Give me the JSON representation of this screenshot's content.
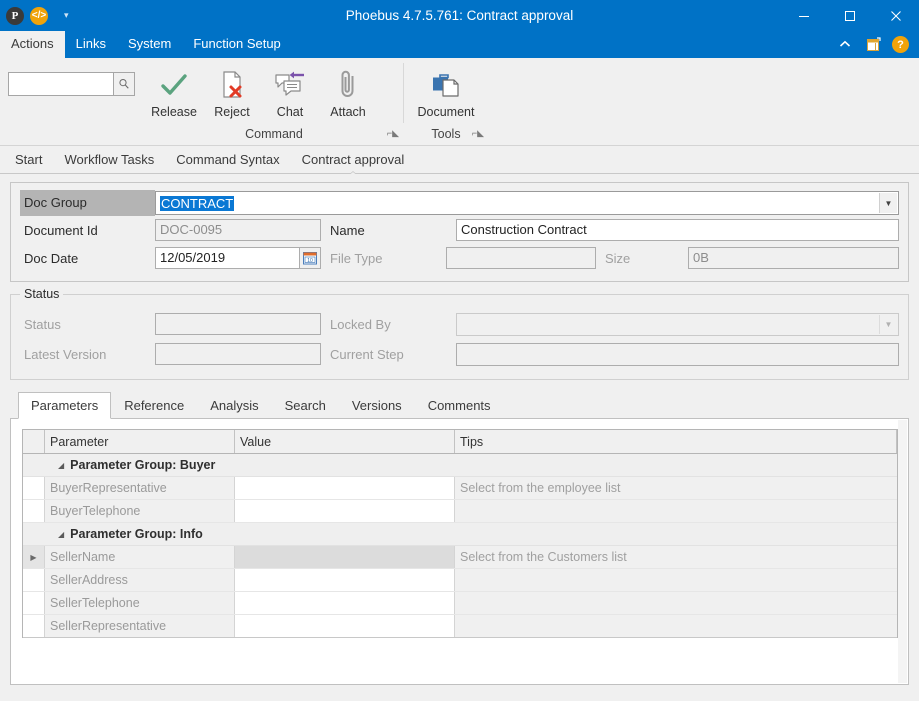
{
  "window": {
    "title": "Phoebus 4.7.5.761: Contract approval",
    "quick_access": [
      {
        "name": "app-logo-icon",
        "glyph": "P"
      },
      {
        "name": "code-icon",
        "glyph": "</>"
      },
      {
        "name": "customize-quick-access-caret",
        "glyph": "▾"
      }
    ],
    "controls": {
      "minimize": "Minimize",
      "maximize": "Maximize",
      "close": "Close"
    }
  },
  "ribbon": {
    "tabs": [
      {
        "label": "Actions",
        "active": true
      },
      {
        "label": "Links",
        "active": false
      },
      {
        "label": "System",
        "active": false
      },
      {
        "label": "Function Setup",
        "active": false
      }
    ],
    "right_icons": [
      {
        "name": "collapse-ribbon-icon",
        "glyph": "^"
      },
      {
        "name": "window-layout-icon",
        "glyph": "▤"
      },
      {
        "name": "help-icon",
        "glyph": "?"
      }
    ],
    "search": {
      "value": "",
      "placeholder": ""
    },
    "groups": [
      {
        "label": "Command",
        "has_launcher": true,
        "buttons": [
          {
            "label": "Release",
            "icon": "checkmark-icon"
          },
          {
            "label": "Reject",
            "icon": "document-reject-icon"
          },
          {
            "label": "Chat",
            "icon": "chat-icon"
          },
          {
            "label": "Attach",
            "icon": "paperclip-icon"
          }
        ]
      },
      {
        "label": "Tools",
        "has_launcher": true,
        "buttons": [
          {
            "label": "Document",
            "icon": "document-tools-icon"
          }
        ]
      }
    ]
  },
  "doc_tabs": [
    {
      "label": "Start",
      "active": false
    },
    {
      "label": "Workflow Tasks",
      "active": false
    },
    {
      "label": "Command Syntax",
      "active": false
    },
    {
      "label": "Contract approval",
      "active": true
    }
  ],
  "form": {
    "doc_group": {
      "label": "Doc Group",
      "value": "CONTRACT",
      "selected": true
    },
    "document_id": {
      "label": "Document Id",
      "value": "DOC-0095"
    },
    "name": {
      "label": "Name",
      "value": "Construction Contract"
    },
    "doc_date": {
      "label": "Doc Date",
      "value": "12/05/2019",
      "calendar_icon": "calendar-icon"
    },
    "file_type": {
      "label": "File Type",
      "value": ""
    },
    "size": {
      "label": "Size",
      "value": "0B"
    }
  },
  "status_group": {
    "title": "Status",
    "status": {
      "label": "Status",
      "value": ""
    },
    "locked_by": {
      "label": "Locked By",
      "value": ""
    },
    "latest_version": {
      "label": "Latest Version",
      "value": ""
    },
    "current_step": {
      "label": "Current Step",
      "value": ""
    }
  },
  "lower_tabs": [
    {
      "label": "Parameters",
      "active": true
    },
    {
      "label": "Reference",
      "active": false
    },
    {
      "label": "Analysis",
      "active": false
    },
    {
      "label": "Search",
      "active": false
    },
    {
      "label": "Versions",
      "active": false
    },
    {
      "label": "Comments",
      "active": false
    }
  ],
  "grid": {
    "columns": [
      "",
      "Parameter",
      "Value",
      "Tips"
    ],
    "rows": [
      {
        "type": "group",
        "label": "Parameter Group: Buyer",
        "expanded": true
      },
      {
        "type": "data",
        "indicator": "",
        "parameter": "BuyerRepresentative",
        "value": "",
        "tips": "Select from the employee list",
        "selected": false
      },
      {
        "type": "data",
        "indicator": "",
        "parameter": "BuyerTelephone",
        "value": "",
        "tips": "",
        "selected": false
      },
      {
        "type": "group",
        "label": "Parameter Group: Info",
        "expanded": true
      },
      {
        "type": "data",
        "indicator": "▶",
        "parameter": "SellerName",
        "value": "",
        "tips": "Select from the Customers list",
        "selected": true
      },
      {
        "type": "data",
        "indicator": "",
        "parameter": "SellerAddress",
        "value": "",
        "tips": "",
        "selected": false
      },
      {
        "type": "data",
        "indicator": "",
        "parameter": "SellerTelephone",
        "value": "",
        "tips": "",
        "selected": false
      },
      {
        "type": "data",
        "indicator": "",
        "parameter": "SellerRepresentative",
        "value": "",
        "tips": "",
        "selected": false
      }
    ]
  },
  "colors": {
    "titlebar": "#0072c6",
    "accent": "#0a78d4",
    "release_green": "#5ba37f",
    "reject_red": "#e23b26",
    "chat_purple": "#7b52ab",
    "document_blue": "#3a74b0",
    "help_orange": "#f0a30a"
  }
}
